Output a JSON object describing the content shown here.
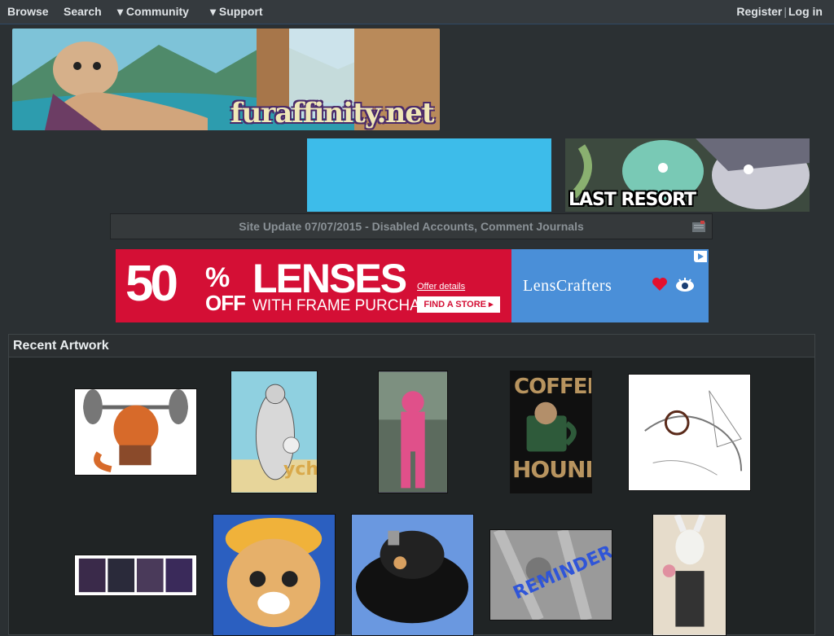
{
  "nav": {
    "browse": "Browse",
    "search": "Search",
    "community": "▾ Community",
    "support": "▾ Support",
    "register": "Register",
    "separator": "|",
    "login": "Log in"
  },
  "banner": {
    "logo_text": "furaffinity.net"
  },
  "ads": {
    "last_resort": "LAST RESORT",
    "lens": {
      "big": "50",
      "percent": "%",
      "off": "OFF",
      "headline": "LENSES",
      "subline": "WITH FRAME PURCHASE",
      "offer": "Offer details",
      "button": "FIND A STORE ▸",
      "brand": "LensCrafters"
    }
  },
  "site_update": "Site Update 07/07/2015 - Disabled Accounts, Comment Journals",
  "recent": {
    "title": "Recent Artwork",
    "labels": {
      "ych": "ych",
      "coffee": "COFFEE",
      "hound": "HOUND",
      "reminder": "REMINDER"
    }
  },
  "colors": {
    "background": "#2b3033",
    "nav_bg": "#353a3e",
    "ad_blue": "#3dbcea",
    "lens_red": "#d40f35",
    "lens_blue": "#4a8fd8"
  }
}
